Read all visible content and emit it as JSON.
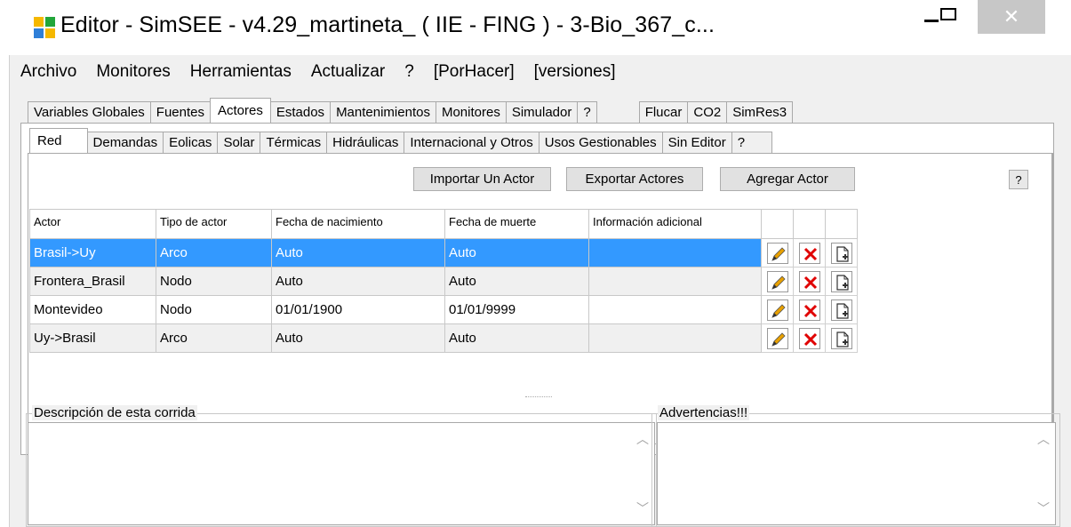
{
  "window": {
    "title": "Editor - SimSEE - v4.29_martineta_ ( IIE - FING ) - 3-Bio_367_c...",
    "close_glyph": "✕",
    "icon_colors": [
      "#f5b800",
      "#22a63a",
      "#2f7fd8",
      "#f5b800"
    ]
  },
  "menu": [
    "Archivo",
    "Monitores",
    "Herramientas",
    "Actualizar",
    "?",
    "[PorHacer]",
    "[versiones]"
  ],
  "main_tabs": [
    "Variables Globales",
    "Fuentes",
    "Actores",
    "Estados",
    "Mantenimientos",
    "Monitores",
    "Simulador",
    "?",
    "Flucar",
    "CO2",
    "SimRes3"
  ],
  "active_main_tab": "Actores",
  "sub_tabs": [
    "Red",
    "Demandas",
    "Eolicas",
    "Solar",
    "Térmicas",
    "Hidráulicas",
    "Internacional y Otros",
    "Usos Gestionables",
    "Sin Editor",
    "?"
  ],
  "active_sub_tab": "Red",
  "toolbar": {
    "import_label": "Importar Un Actor",
    "export_label": "Exportar Actores",
    "add_label": "Agregar Actor",
    "help_label": "?"
  },
  "table": {
    "columns": [
      "Actor",
      "Tipo de actor",
      "Fecha de nacimiento",
      "Fecha de muerte",
      "Información adicional",
      "",
      "",
      ""
    ],
    "rows": [
      {
        "actor": "Brasil->Uy",
        "tipo": "Arco",
        "nacimiento": "Auto",
        "muerte": "Auto",
        "info": ""
      },
      {
        "actor": "Frontera_Brasil",
        "tipo": "Nodo",
        "nacimiento": "Auto",
        "muerte": "Auto",
        "info": ""
      },
      {
        "actor": "Montevideo",
        "tipo": "Nodo",
        "nacimiento": "01/01/1900",
        "muerte": "01/01/9999",
        "info": ""
      },
      {
        "actor": "Uy->Brasil",
        "tipo": "Arco",
        "nacimiento": "Auto",
        "muerte": "Auto",
        "info": ""
      }
    ],
    "selected_row": 0,
    "row_actions": [
      "edit-icon",
      "delete-icon",
      "clone-icon"
    ]
  },
  "description": {
    "label": "Descripción de esta corrida",
    "value": ""
  },
  "warnings": {
    "label": "Advertencias!!!",
    "value": ""
  },
  "scroll": {
    "up": "︿",
    "down": "﹀"
  },
  "colors": {
    "selection": "#3399ff",
    "delete": "#e00000",
    "pencil": "#e8a000"
  }
}
